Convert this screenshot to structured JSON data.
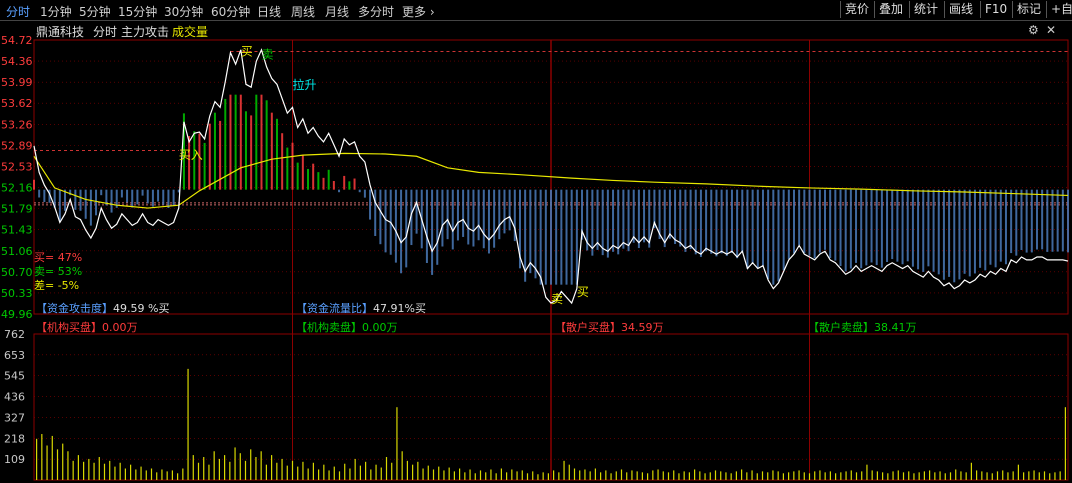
{
  "toolbar": {
    "tabs": [
      "分时",
      "1分钟",
      "5分钟",
      "15分钟",
      "30分钟",
      "60分钟",
      "日线",
      "周线",
      "月线",
      "多分时",
      "更多"
    ],
    "right_buttons": [
      "竞价",
      "叠加",
      "统计",
      "画线",
      "F10",
      "标记",
      "+自"
    ]
  },
  "header": {
    "stock_name": "鼎通科技",
    "period": "分时",
    "indicator": "主力攻击",
    "volume_label": "成交量"
  },
  "info": {
    "buy_ratio": "买= 47%",
    "sell_ratio": "卖= 53%",
    "diff_ratio": "差= -5%",
    "attack_label": "【资金攻击度】",
    "attack_value": "49.59 %买",
    "flow_label": "【资金流量比】",
    "flow_value": "47.91%买",
    "inst_buy_label": "【机构买盘】",
    "inst_buy_value": "0.00万",
    "inst_sell_label": "【机构卖盘】",
    "inst_sell_value": "0.00万",
    "retail_buy_label": "【散户买盘】",
    "retail_buy_value": "34.59万",
    "retail_sell_label": "【散户卖盘】",
    "retail_sell_value": "38.41万"
  },
  "colors": {
    "up": "#ff3c3c",
    "down": "#00c800",
    "price_line": "#ffffff",
    "avg_line": "#e8e800",
    "volume": "#d8d800",
    "grid": "#8b0000",
    "link_blue": "#5aa0ff"
  },
  "chart_data": [
    {
      "type": "line",
      "ylim": [
        49.96,
        54.72
      ],
      "yticks": [
        "54.72",
        "54.36",
        "53.99",
        "53.62",
        "53.26",
        "52.89",
        "52.53",
        "52.16",
        "51.79",
        "51.43",
        "51.06",
        "50.70",
        "50.33",
        "49.96"
      ],
      "prev_close": 51.89,
      "annotations": [
        {
          "text": "买",
          "x": 0.2,
          "y": 54.45,
          "color": "#e8e800"
        },
        {
          "text": "卖",
          "x": 0.22,
          "y": 54.4,
          "color": "#00c800"
        },
        {
          "text": "拉升",
          "x": 0.25,
          "y": 53.87,
          "color": "#00e5e5"
        },
        {
          "text": "买入",
          "x": 0.14,
          "y": 52.65,
          "color": "#e8e800"
        },
        {
          "text": "卖",
          "x": 0.5,
          "y": 50.15,
          "color": "#e8e800"
        },
        {
          "text": "买",
          "x": 0.525,
          "y": 50.27,
          "color": "#e8e800"
        }
      ],
      "price": [
        [
          0.0,
          52.88
        ],
        [
          0.005,
          52.42
        ],
        [
          0.01,
          52.2
        ],
        [
          0.015,
          52.05
        ],
        [
          0.02,
          51.82
        ],
        [
          0.025,
          51.55
        ],
        [
          0.03,
          51.7
        ],
        [
          0.035,
          51.95
        ],
        [
          0.04,
          51.65
        ],
        [
          0.045,
          51.6
        ],
        [
          0.05,
          51.42
        ],
        [
          0.055,
          51.28
        ],
        [
          0.06,
          51.45
        ],
        [
          0.065,
          51.8
        ],
        [
          0.07,
          51.6
        ],
        [
          0.075,
          51.45
        ],
        [
          0.08,
          51.52
        ],
        [
          0.085,
          51.7
        ],
        [
          0.09,
          51.6
        ],
        [
          0.095,
          51.5
        ],
        [
          0.1,
          51.55
        ],
        [
          0.105,
          51.7
        ],
        [
          0.11,
          51.55
        ],
        [
          0.115,
          51.5
        ],
        [
          0.12,
          51.6
        ],
        [
          0.125,
          51.55
        ],
        [
          0.13,
          51.5
        ],
        [
          0.135,
          51.55
        ],
        [
          0.14,
          51.8
        ],
        [
          0.145,
          53.3
        ],
        [
          0.15,
          52.95
        ],
        [
          0.155,
          53.1
        ],
        [
          0.16,
          53.12
        ],
        [
          0.165,
          53.0
        ],
        [
          0.17,
          53.4
        ],
        [
          0.175,
          53.65
        ],
        [
          0.18,
          53.55
        ],
        [
          0.185,
          54.0
        ],
        [
          0.19,
          54.5
        ],
        [
          0.195,
          54.3
        ],
        [
          0.2,
          54.55
        ],
        [
          0.205,
          53.95
        ],
        [
          0.21,
          53.9
        ],
        [
          0.215,
          54.35
        ],
        [
          0.22,
          54.55
        ],
        [
          0.225,
          54.25
        ],
        [
          0.23,
          54.05
        ],
        [
          0.235,
          53.95
        ],
        [
          0.24,
          53.7
        ],
        [
          0.245,
          53.45
        ],
        [
          0.25,
          53.55
        ],
        [
          0.255,
          53.2
        ],
        [
          0.26,
          53.35
        ],
        [
          0.265,
          53.1
        ],
        [
          0.27,
          53.2
        ],
        [
          0.275,
          53.05
        ],
        [
          0.28,
          52.95
        ],
        [
          0.285,
          53.1
        ],
        [
          0.29,
          52.9
        ],
        [
          0.295,
          52.7
        ],
        [
          0.3,
          53.0
        ],
        [
          0.305,
          52.9
        ],
        [
          0.31,
          52.95
        ],
        [
          0.315,
          52.7
        ],
        [
          0.32,
          52.6
        ],
        [
          0.325,
          52.2
        ],
        [
          0.33,
          51.9
        ],
        [
          0.335,
          51.75
        ],
        [
          0.34,
          51.6
        ],
        [
          0.345,
          51.55
        ],
        [
          0.35,
          51.4
        ],
        [
          0.355,
          51.2
        ],
        [
          0.36,
          51.3
        ],
        [
          0.365,
          51.7
        ],
        [
          0.37,
          51.9
        ],
        [
          0.375,
          51.6
        ],
        [
          0.38,
          51.3
        ],
        [
          0.385,
          51.05
        ],
        [
          0.39,
          51.2
        ],
        [
          0.395,
          51.5
        ],
        [
          0.4,
          51.6
        ],
        [
          0.405,
          51.4
        ],
        [
          0.41,
          51.55
        ],
        [
          0.415,
          51.6
        ],
        [
          0.42,
          51.45
        ],
        [
          0.425,
          51.4
        ],
        [
          0.43,
          51.5
        ],
        [
          0.435,
          51.35
        ],
        [
          0.44,
          51.25
        ],
        [
          0.445,
          51.35
        ],
        [
          0.45,
          51.5
        ],
        [
          0.455,
          51.6
        ],
        [
          0.46,
          51.65
        ],
        [
          0.465,
          51.45
        ],
        [
          0.47,
          50.95
        ],
        [
          0.475,
          50.7
        ],
        [
          0.48,
          50.85
        ],
        [
          0.485,
          50.75
        ],
        [
          0.49,
          50.6
        ],
        [
          0.495,
          50.25
        ],
        [
          0.5,
          50.15
        ],
        [
          0.505,
          50.2
        ],
        [
          0.51,
          50.35
        ],
        [
          0.515,
          50.25
        ],
        [
          0.52,
          50.15
        ],
        [
          0.525,
          50.4
        ],
        [
          0.53,
          51.4
        ],
        [
          0.535,
          51.2
        ],
        [
          0.54,
          51.1
        ],
        [
          0.545,
          51.2
        ],
        [
          0.55,
          51.1
        ],
        [
          0.555,
          51.05
        ],
        [
          0.56,
          51.15
        ],
        [
          0.565,
          51.1
        ],
        [
          0.57,
          51.2
        ],
        [
          0.575,
          51.15
        ],
        [
          0.58,
          51.3
        ],
        [
          0.585,
          51.2
        ],
        [
          0.59,
          51.3
        ],
        [
          0.595,
          51.2
        ],
        [
          0.6,
          51.55
        ],
        [
          0.605,
          51.35
        ],
        [
          0.61,
          51.2
        ],
        [
          0.615,
          51.35
        ],
        [
          0.62,
          51.25
        ],
        [
          0.625,
          51.2
        ],
        [
          0.63,
          51.1
        ],
        [
          0.635,
          51.15
        ],
        [
          0.64,
          51.05
        ],
        [
          0.645,
          51.0
        ],
        [
          0.65,
          51.1
        ],
        [
          0.655,
          51.05
        ],
        [
          0.66,
          51.0
        ],
        [
          0.665,
          51.05
        ],
        [
          0.67,
          51.0
        ],
        [
          0.675,
          51.05
        ],
        [
          0.68,
          50.95
        ],
        [
          0.685,
          51.05
        ],
        [
          0.69,
          50.75
        ],
        [
          0.695,
          50.85
        ],
        [
          0.7,
          50.75
        ],
        [
          0.705,
          50.8
        ],
        [
          0.71,
          50.55
        ],
        [
          0.715,
          50.4
        ],
        [
          0.72,
          50.5
        ],
        [
          0.725,
          50.7
        ],
        [
          0.73,
          50.9
        ],
        [
          0.735,
          51.0
        ],
        [
          0.74,
          51.15
        ],
        [
          0.745,
          51.0
        ],
        [
          0.75,
          50.95
        ],
        [
          0.755,
          50.9
        ],
        [
          0.76,
          51.0
        ],
        [
          0.765,
          51.05
        ],
        [
          0.77,
          50.9
        ],
        [
          0.775,
          50.85
        ],
        [
          0.78,
          50.75
        ],
        [
          0.785,
          50.65
        ],
        [
          0.79,
          50.7
        ],
        [
          0.795,
          50.8
        ],
        [
          0.8,
          50.7
        ],
        [
          0.805,
          50.75
        ],
        [
          0.81,
          50.8
        ],
        [
          0.815,
          50.75
        ],
        [
          0.82,
          50.7
        ],
        [
          0.825,
          50.8
        ],
        [
          0.83,
          50.85
        ],
        [
          0.835,
          50.8
        ],
        [
          0.84,
          50.75
        ],
        [
          0.845,
          50.8
        ],
        [
          0.85,
          50.7
        ],
        [
          0.855,
          50.65
        ],
        [
          0.86,
          50.6
        ],
        [
          0.865,
          50.7
        ],
        [
          0.87,
          50.6
        ],
        [
          0.875,
          50.55
        ],
        [
          0.88,
          50.45
        ],
        [
          0.885,
          50.5
        ],
        [
          0.89,
          50.4
        ],
        [
          0.895,
          50.45
        ],
        [
          0.9,
          50.55
        ],
        [
          0.905,
          50.5
        ],
        [
          0.91,
          50.55
        ],
        [
          0.915,
          50.65
        ],
        [
          0.92,
          50.6
        ],
        [
          0.925,
          50.7
        ],
        [
          0.93,
          50.65
        ],
        [
          0.935,
          50.75
        ],
        [
          0.94,
          50.7
        ],
        [
          0.945,
          50.9
        ],
        [
          0.95,
          50.85
        ],
        [
          0.955,
          50.95
        ],
        [
          0.96,
          50.9
        ],
        [
          0.965,
          50.9
        ],
        [
          0.97,
          50.95
        ],
        [
          0.975,
          50.95
        ],
        [
          0.98,
          50.9
        ],
        [
          0.985,
          50.9
        ],
        [
          0.99,
          50.9
        ],
        [
          0.995,
          50.9
        ],
        [
          1.0,
          50.88
        ]
      ],
      "avg": [
        [
          0.0,
          52.7
        ],
        [
          0.02,
          52.15
        ],
        [
          0.05,
          51.95
        ],
        [
          0.08,
          51.85
        ],
        [
          0.11,
          51.8
        ],
        [
          0.14,
          51.85
        ],
        [
          0.16,
          52.1
        ],
        [
          0.18,
          52.3
        ],
        [
          0.2,
          52.5
        ],
        [
          0.23,
          52.65
        ],
        [
          0.26,
          52.72
        ],
        [
          0.3,
          52.75
        ],
        [
          0.34,
          52.74
        ],
        [
          0.37,
          52.7
        ],
        [
          0.4,
          52.5
        ],
        [
          0.43,
          52.42
        ],
        [
          0.47,
          52.38
        ],
        [
          0.52,
          52.32
        ],
        [
          0.56,
          52.28
        ],
        [
          0.6,
          52.25
        ],
        [
          0.65,
          52.22
        ],
        [
          0.7,
          52.18
        ],
        [
          0.75,
          52.15
        ],
        [
          0.8,
          52.13
        ],
        [
          0.85,
          52.1
        ],
        [
          0.9,
          52.08
        ],
        [
          0.95,
          52.05
        ],
        [
          1.0,
          52.02
        ]
      ]
    },
    {
      "type": "bar",
      "title": "成交量",
      "ylim": [
        0,
        762
      ],
      "yticks": [
        "762",
        "653",
        "545",
        "436",
        "327",
        "218",
        "109"
      ],
      "values": [
        215,
        240,
        180,
        230,
        160,
        190,
        150,
        100,
        130,
        95,
        110,
        90,
        120,
        85,
        100,
        70,
        90,
        60,
        80,
        55,
        70,
        50,
        60,
        40,
        55,
        45,
        50,
        35,
        60,
        580,
        130,
        90,
        120,
        80,
        150,
        110,
        130,
        95,
        170,
        140,
        100,
        160,
        120,
        150,
        80,
        130,
        90,
        110,
        75,
        100,
        70,
        95,
        60,
        90,
        55,
        80,
        50,
        70,
        45,
        85,
        60,
        110,
        75,
        95,
        55,
        80,
        65,
        120,
        90,
        380,
        150,
        100,
        80,
        95,
        60,
        75,
        55,
        70,
        50,
        65,
        45,
        60,
        40,
        55,
        35,
        50,
        40,
        55,
        35,
        60,
        40,
        55,
        45,
        50,
        35,
        45,
        30,
        40,
        35,
        50,
        40,
        100,
        80,
        60,
        50,
        55,
        45,
        60,
        40,
        50,
        35,
        45,
        55,
        40,
        50,
        45,
        40,
        35,
        50,
        55,
        45,
        40,
        50,
        35,
        45,
        40,
        55,
        45,
        35,
        40,
        50,
        45,
        40,
        35,
        45,
        55,
        40,
        50,
        35,
        45,
        40,
        50,
        45,
        35,
        40,
        45,
        50,
        40,
        35,
        45,
        50,
        40,
        45,
        35,
        40,
        45,
        50,
        40,
        45,
        80,
        50,
        45,
        40,
        35,
        45,
        50,
        40,
        45,
        35,
        40,
        45,
        50,
        40,
        45,
        35,
        40,
        55,
        45,
        40,
        90,
        50,
        45,
        40,
        35,
        45,
        50,
        40,
        45,
        80,
        40,
        45,
        50,
        40,
        45,
        35,
        40,
        45,
        380
      ]
    }
  ]
}
